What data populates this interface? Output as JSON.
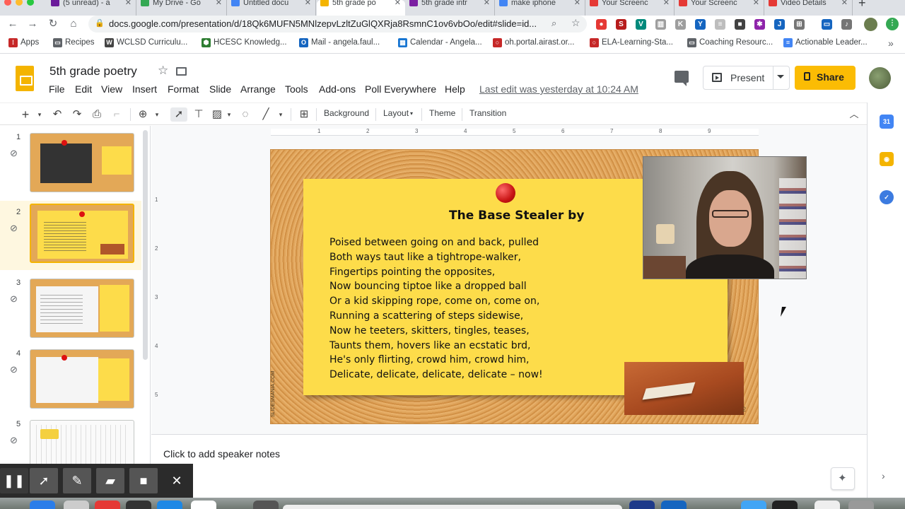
{
  "browser": {
    "tabs": [
      {
        "label": "(5 unread) - a",
        "color": "#6a1b9a"
      },
      {
        "label": "My Drive - Go",
        "color": "#34a853"
      },
      {
        "label": "Untitled docu",
        "color": "#4285f4"
      },
      {
        "label": "5th grade po",
        "color": "#f4b400",
        "active": true
      },
      {
        "label": "5th grade intr",
        "color": "#7b1fa2"
      },
      {
        "label": "make iphone",
        "color": "#4285f4"
      },
      {
        "label": "Your Screenc",
        "color": "#e53935"
      },
      {
        "label": "Your Screenc",
        "color": "#e53935"
      },
      {
        "label": "Video Details",
        "color": "#e53935"
      }
    ],
    "new_tab": "+",
    "url": "docs.google.com/presentation/d/18Qk6MUFN5MNlzepvLzltZuGlQXRja8RsmnC1ov6vbOo/edit#slide=id...",
    "bookmarks": [
      {
        "label": "Apps",
        "color": "#c62828"
      },
      {
        "label": "Recipes",
        "color": "#5f6368"
      },
      {
        "label": "WCLSD Curriculu...",
        "color": "#444444"
      },
      {
        "label": "HCESC Knowledg...",
        "color": "#2e7d32"
      },
      {
        "label": "Mail - angela.faul...",
        "color": "#1565c0"
      },
      {
        "label": "Calendar - Angela...",
        "color": "#1976d2"
      },
      {
        "label": "oh.portal.airast.or...",
        "color": "#c62828"
      },
      {
        "label": "ELA-Learning-Sta...",
        "color": "#c62828"
      },
      {
        "label": "Coaching Resourc...",
        "color": "#5f6368"
      },
      {
        "label": "Actionable Leader...",
        "color": "#4285f4"
      }
    ]
  },
  "doc": {
    "title": "5th grade poetry",
    "menus": [
      "File",
      "Edit",
      "View",
      "Insert",
      "Format",
      "Slide",
      "Arrange",
      "Tools",
      "Add-ons",
      "Poll Everywhere",
      "Help"
    ],
    "last_edit": "Last edit was yesterday at 10:24 AM",
    "present_label": "Present",
    "share_label": "Share"
  },
  "toolbar": {
    "background": "Background",
    "layout": "Layout",
    "theme": "Theme",
    "transition": "Transition"
  },
  "ruler": {
    "top_ticks": [
      "1",
      "2",
      "3",
      "4",
      "5",
      "6",
      "7",
      "8",
      "9"
    ],
    "left_ticks": [
      "1",
      "2",
      "3",
      "4",
      "5"
    ]
  },
  "filmstrip": {
    "slides": [
      {
        "num": "1"
      },
      {
        "num": "2",
        "active": true
      },
      {
        "num": "3"
      },
      {
        "num": "4"
      },
      {
        "num": "5"
      }
    ]
  },
  "slide": {
    "title": "The Base Stealer by",
    "poem_lines": [
      "Poised between going on and back, pulled",
      "Both ways taut like a tightrope-walker,",
      "Fingertips pointing the opposites,",
      "Now bouncing tiptoe like a dropped ball",
      "Or a kid skipping rope, come on, come on,",
      "Running a scattering of steps sidewise,",
      "Now he teeters, skitters, tingles, teases,",
      "Taunts them, hovers like an ecstatic brd,",
      "He's only flirting, crowd him, crowd him,",
      "Delicate, delicate, delicate, delicate – now!"
    ],
    "credit": "SLIDESMANIA.COM",
    "number": "2"
  },
  "notes": {
    "placeholder": "Click to add speaker notes"
  }
}
